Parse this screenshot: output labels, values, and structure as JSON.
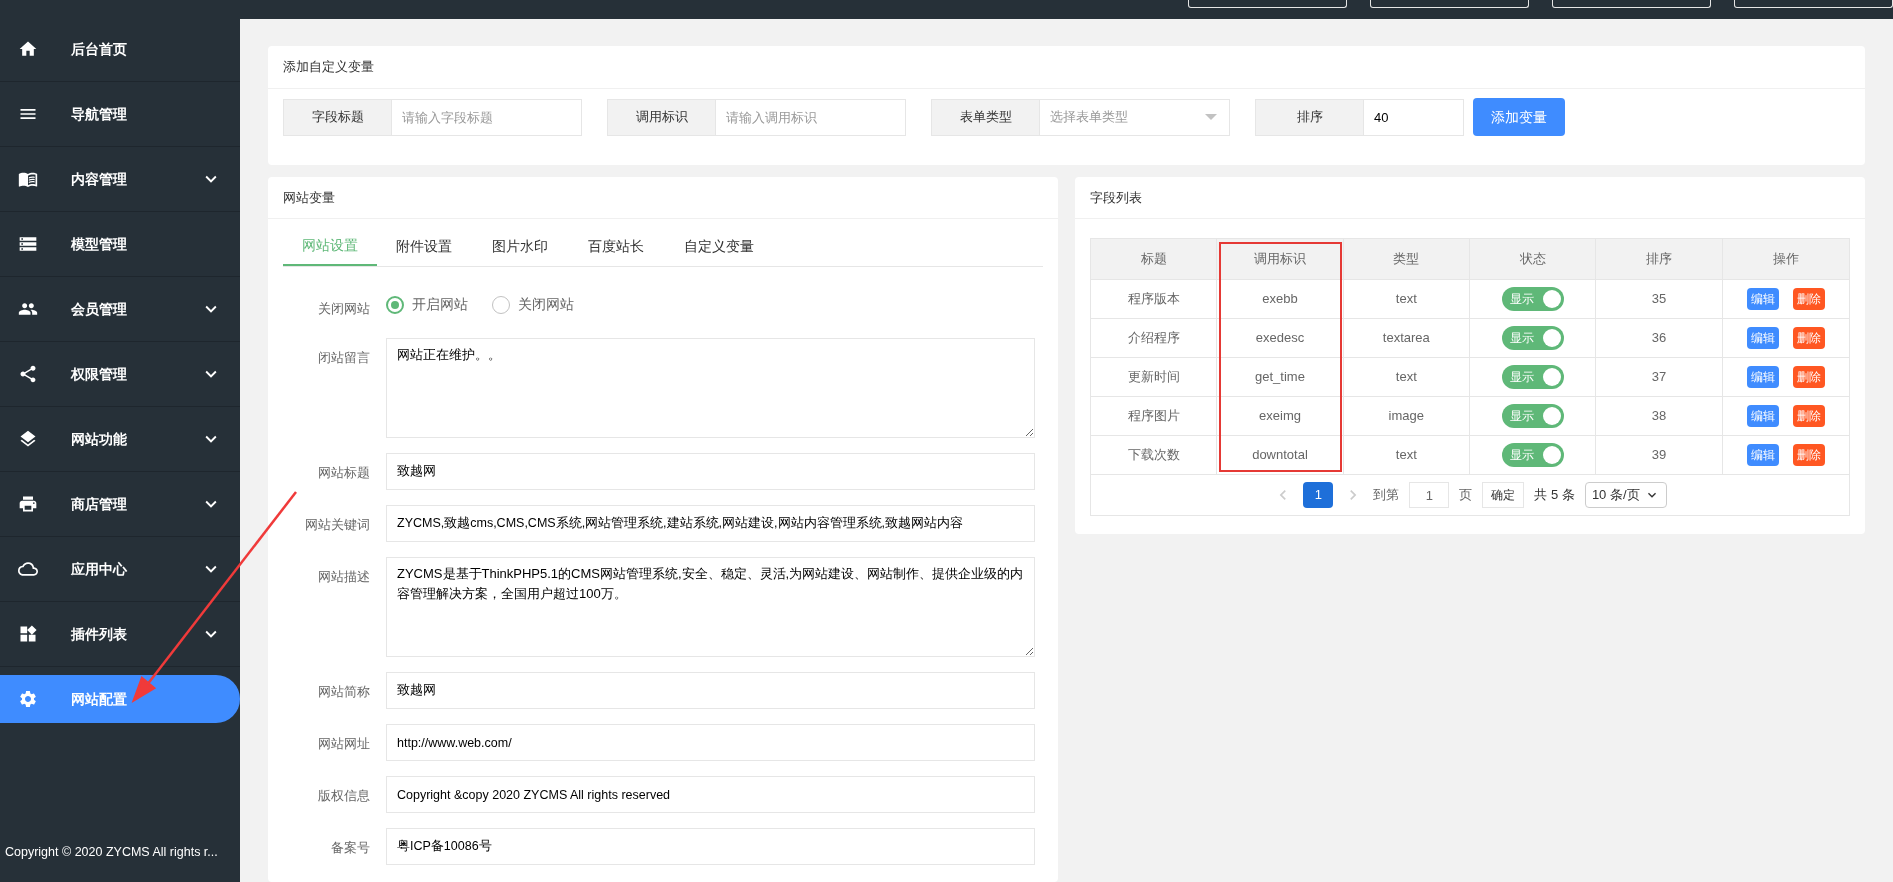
{
  "sidebar": {
    "items": [
      {
        "label": "后台首页",
        "expandable": false,
        "selected": false
      },
      {
        "label": "导航管理",
        "expandable": false,
        "selected": false
      },
      {
        "label": "内容管理",
        "expandable": true,
        "selected": false
      },
      {
        "label": "模型管理",
        "expandable": false,
        "selected": false
      },
      {
        "label": "会员管理",
        "expandable": true,
        "selected": false
      },
      {
        "label": "权限管理",
        "expandable": true,
        "selected": false
      },
      {
        "label": "网站功能",
        "expandable": true,
        "selected": false
      },
      {
        "label": "商店管理",
        "expandable": true,
        "selected": false
      },
      {
        "label": "应用中心",
        "expandable": true,
        "selected": false
      },
      {
        "label": "插件列表",
        "expandable": true,
        "selected": false
      },
      {
        "label": "网站配置",
        "expandable": false,
        "selected": true
      }
    ],
    "footer": "Copyright © 2020 ZYCMS All rights r..."
  },
  "add_variable": {
    "title": "添加自定义变量",
    "fields": [
      {
        "kind": "input",
        "label": "字段标题",
        "placeholder": "请输入字段标题"
      },
      {
        "kind": "input",
        "label": "调用标识",
        "placeholder": "请输入调用标识"
      },
      {
        "kind": "select",
        "label": "表单类型",
        "placeholder": "选择表单类型"
      },
      {
        "kind": "number",
        "label": "排序",
        "value": "40"
      }
    ],
    "button": "添加变量"
  },
  "site_variables": {
    "title": "网站变量",
    "tabs": [
      {
        "label": "网站设置",
        "selected": true
      },
      {
        "label": "附件设置",
        "selected": false
      },
      {
        "label": "图片水印",
        "selected": false
      },
      {
        "label": "百度站长",
        "selected": false
      },
      {
        "label": "自定义变量",
        "selected": false
      }
    ],
    "form": [
      {
        "kind": "radio",
        "label": "关闭网站",
        "options": [
          {
            "label": "开启网站",
            "selected": true
          },
          {
            "label": "关闭网站",
            "selected": false
          }
        ]
      },
      {
        "kind": "textarea",
        "label": "闭站留言",
        "value": "网站正在维护。。"
      },
      {
        "kind": "input",
        "label": "网站标题",
        "value": "致越网"
      },
      {
        "kind": "input",
        "label": "网站关键词",
        "value": "ZYCMS,致越cms,CMS,CMS系统,网站管理系统,建站系统,网站建设,网站内容管理系统,致越网站内容"
      },
      {
        "kind": "textarea",
        "label": "网站描述",
        "value": "ZYCMS是基于ThinkPHP5.1的CMS网站管理系统,安全、稳定、灵活,为网站建设、网站制作、提供企业级的内容管理解决方案，全国用户超过100万。"
      },
      {
        "kind": "input",
        "label": "网站简称",
        "value": "致越网"
      },
      {
        "kind": "input",
        "label": "网站网址",
        "value": "http://www.web.com/"
      },
      {
        "kind": "input",
        "label": "版权信息",
        "value": "Copyright &copy 2020 ZYCMS All rights reserved"
      },
      {
        "kind": "input",
        "label": "备案号",
        "value": "粤ICP备10086号"
      }
    ]
  },
  "field_list": {
    "title": "字段列表",
    "columns": [
      "标题",
      "调用标识",
      "类型",
      "状态",
      "排序",
      "操作"
    ],
    "rows": [
      {
        "title": "程序版本",
        "key": "exebb",
        "type": "text",
        "status": {
          "label": "显示",
          "on": true
        },
        "order": "35",
        "edit": "编辑",
        "delete": "删除"
      },
      {
        "title": "介绍程序",
        "key": "exedesc",
        "type": "textarea",
        "status": {
          "label": "显示",
          "on": true
        },
        "order": "36",
        "edit": "编辑",
        "delete": "删除"
      },
      {
        "title": "更新时间",
        "key": "get_time",
        "type": "text",
        "status": {
          "label": "显示",
          "on": true
        },
        "order": "37",
        "edit": "编辑",
        "delete": "删除"
      },
      {
        "title": "程序图片",
        "key": "exeimg",
        "type": "image",
        "status": {
          "label": "显示",
          "on": true
        },
        "order": "38",
        "edit": "编辑",
        "delete": "删除"
      },
      {
        "title": "下载次数",
        "key": "downtotal",
        "type": "text",
        "status": {
          "label": "显示",
          "on": true
        },
        "order": "39",
        "edit": "编辑",
        "delete": "删除"
      }
    ],
    "pagination": {
      "pages": [
        {
          "label": "1",
          "selected": true
        }
      ],
      "goto_label": "到第",
      "goto_value": "1",
      "page_label": "页",
      "confirm": "确定",
      "total": "共 5 条",
      "per_page": "10 条/页"
    }
  }
}
